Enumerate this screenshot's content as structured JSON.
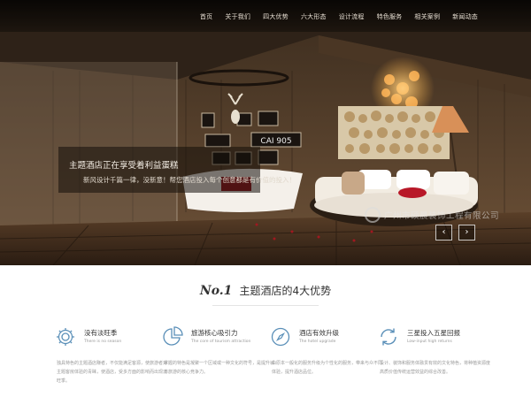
{
  "nav": {
    "items": [
      "首页",
      "关于我们",
      "四大优势",
      "六大形态",
      "设计流程",
      "特色服务",
      "相关案例",
      "新闻动态"
    ]
  },
  "hero": {
    "caption_title": "主题酒店正在享受着利益蛋糕",
    "caption_sub": "新风设计千篇一律，没新意！帮您酒店投入每个创意都是有价值的投入！",
    "prev_label": "‹",
    "next_label": "›",
    "watermark": "广州市硕晨装饰工程有限公司",
    "sign_text": "CAI 905"
  },
  "advantages": {
    "number": "No.1",
    "title": "主题酒店的4大优势",
    "items": [
      {
        "icon": "gear-icon",
        "title": "没有淡旺季",
        "en": "There is no season",
        "desc": "独具特色的主题酒店赚者，不仅能满足客源，使旅游者对主题客房体验的青睐，使酒店，受多方面的影响而出现淡旺季。"
      },
      {
        "icon": "pie-chart-icon",
        "title": "旅游核心吸引力",
        "en": "The core of tourism attraction",
        "desc": "掌握的特色是凝聚一个区域或一种文化的符号，是提升城市旅游的核心竞争力。"
      },
      {
        "icon": "compass-icon",
        "title": "酒店有效升级",
        "en": "The hotel upgrade",
        "desc": "由原本一般化的服务升级为个性化的服务，带来与众不同体验，提升酒店品位。"
      },
      {
        "icon": "refresh-icon",
        "title": "三星投入五星回报",
        "en": "Low-input high returns",
        "desc": "设计、装饰和服务体融贯有效的文化特色，将种植资源度高质价值传统运营效益的综合改善。"
      }
    ]
  },
  "colors": {
    "accent_blue": "#5a8fb8",
    "text_dark": "#333333",
    "text_muted": "#9a9a9a"
  }
}
